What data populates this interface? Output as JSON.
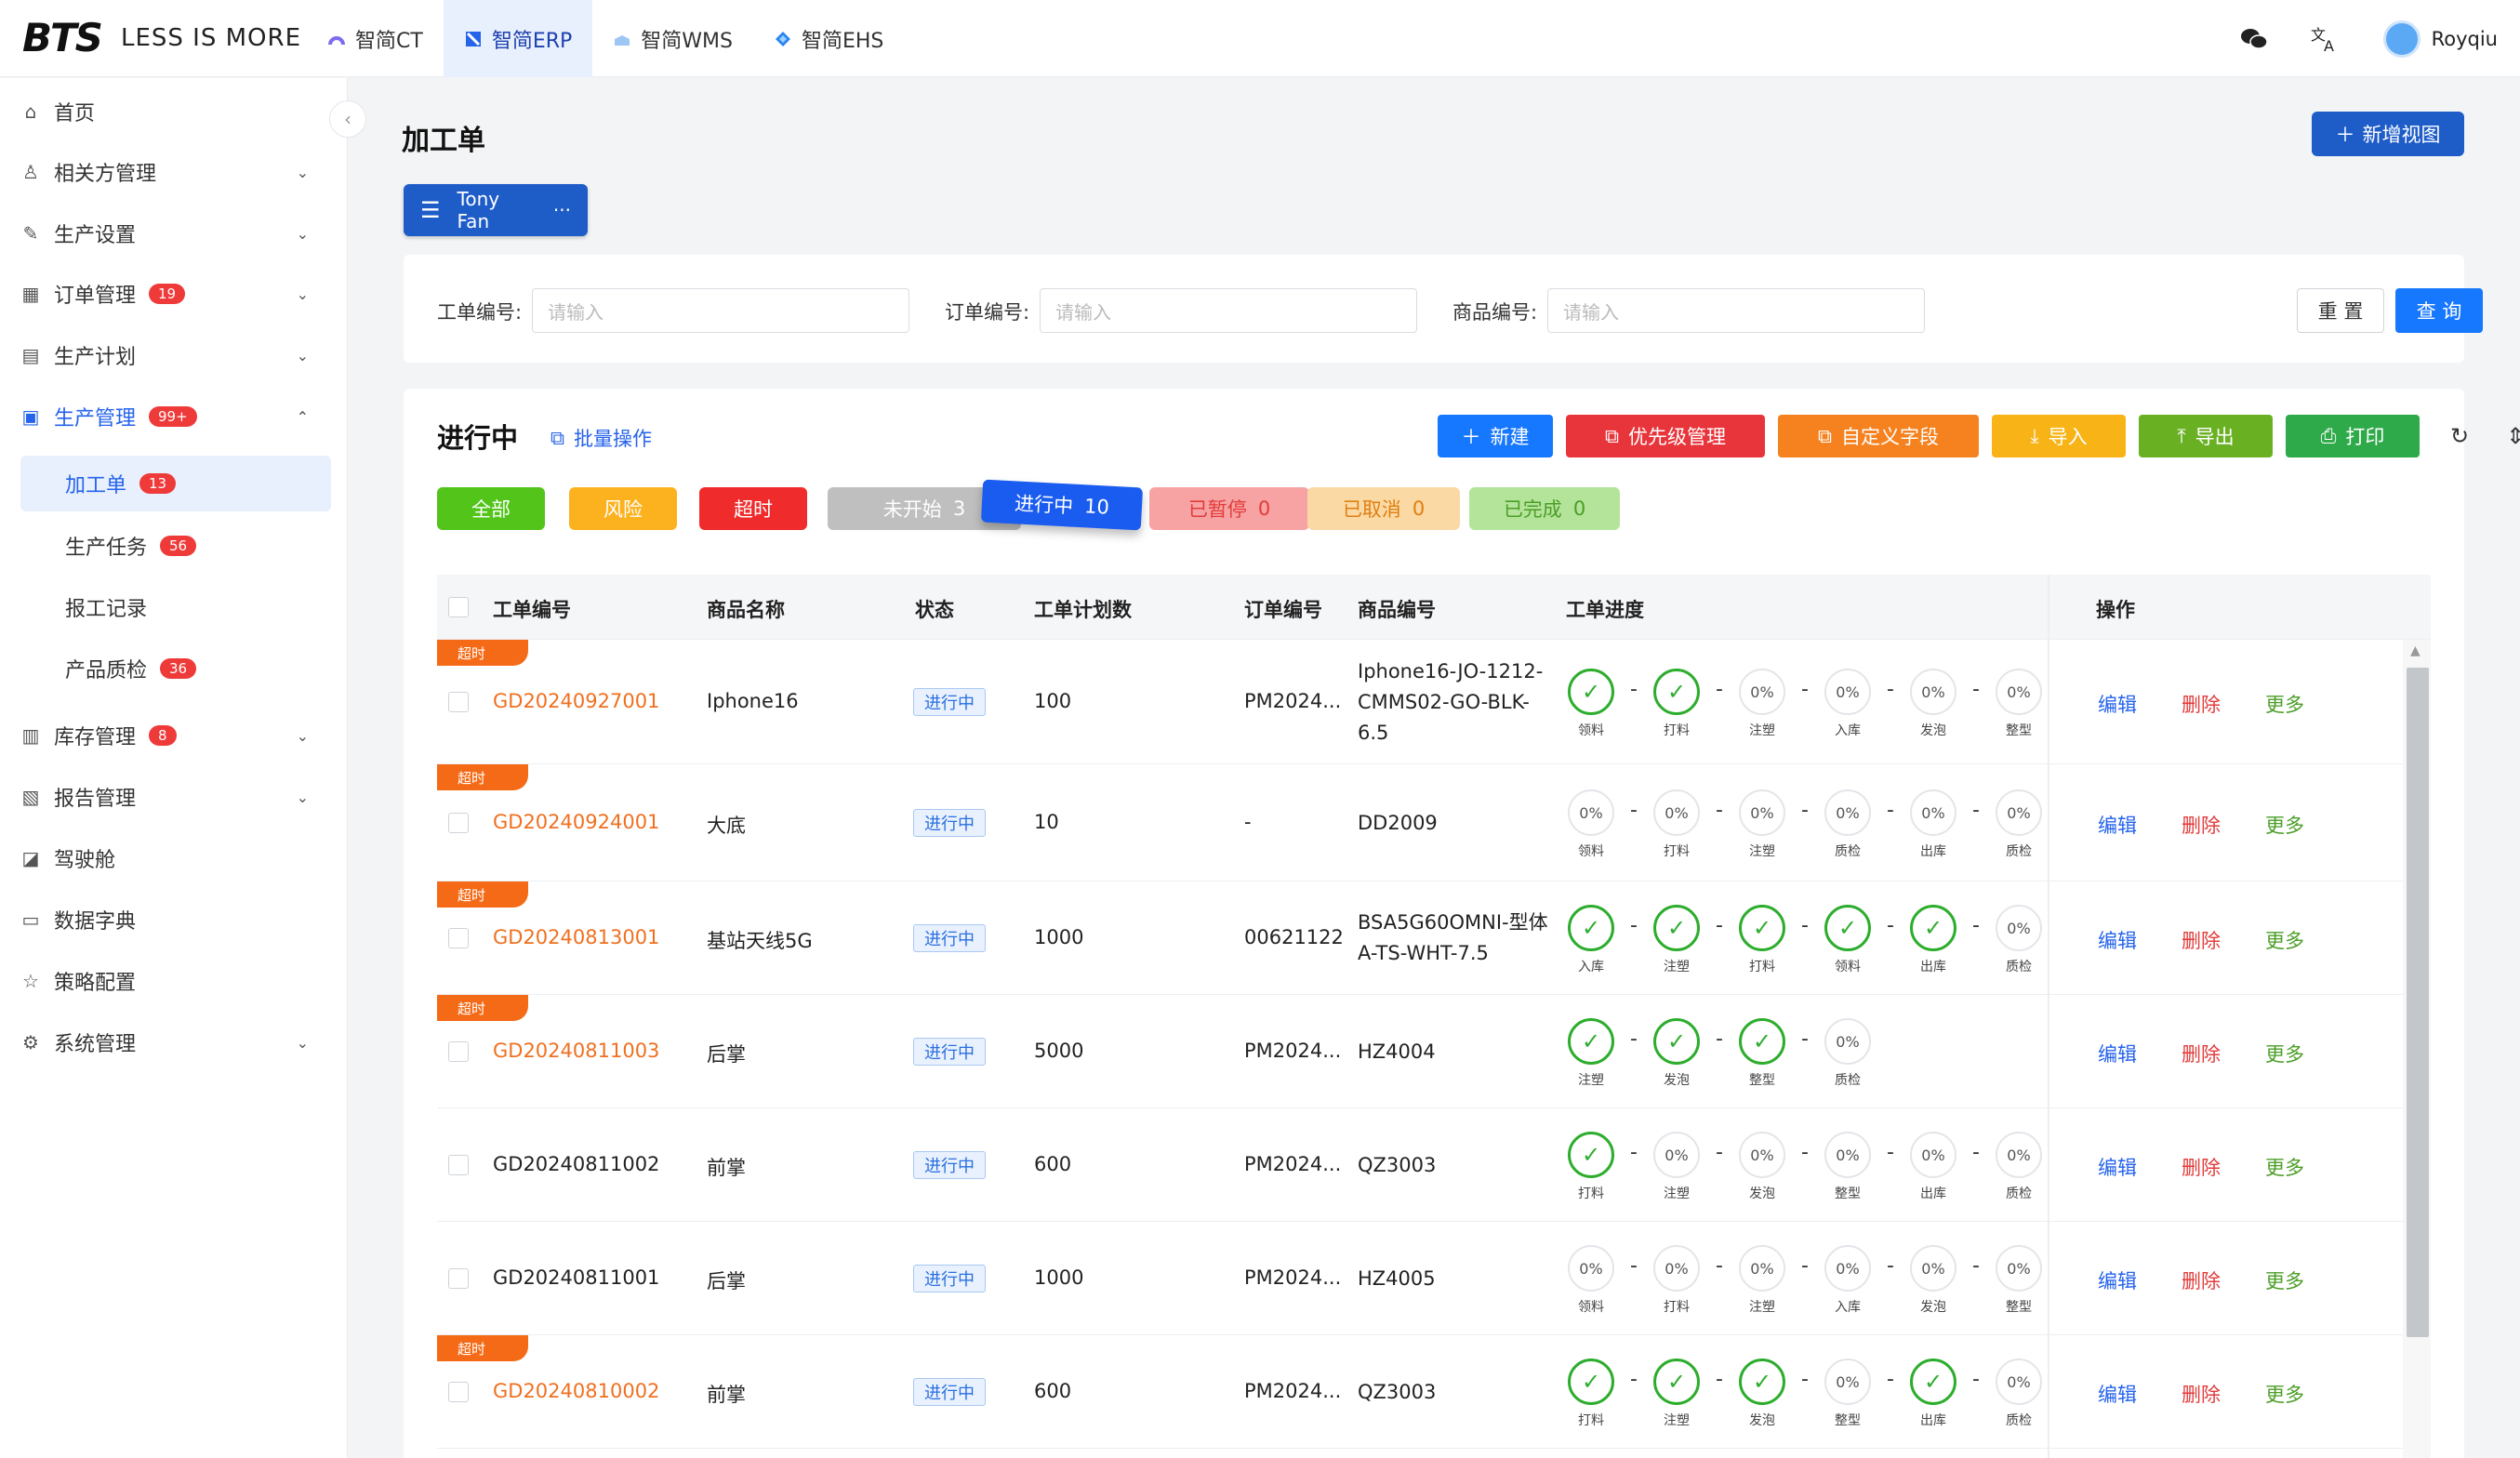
{
  "topbar": {
    "logo": "BTS",
    "slogan": "LESS IS MORE",
    "apps": [
      {
        "label": "智简CT",
        "icon": "ct-app-icon"
      },
      {
        "label": "智简ERP",
        "icon": "erp-app-icon",
        "active": true
      },
      {
        "label": "智简WMS",
        "icon": "wms-app-icon"
      },
      {
        "label": "智简EHS",
        "icon": "ehs-app-icon"
      }
    ],
    "user": "Royqiu"
  },
  "sidebar": {
    "items": [
      {
        "label": "首页",
        "icon": "home-icon"
      },
      {
        "label": "相关方管理",
        "icon": "user-icon"
      },
      {
        "label": "生产设置",
        "icon": "pen-icon"
      },
      {
        "label": "订单管理",
        "icon": "grid-icon",
        "badge": "19"
      },
      {
        "label": "生产计划",
        "icon": "calendar-icon"
      },
      {
        "label": "生产管理",
        "icon": "layers-icon",
        "badge": "99+"
      },
      {
        "label": "库存管理",
        "icon": "box-icon",
        "badge": "8"
      },
      {
        "label": "报告管理",
        "icon": "report-icon"
      },
      {
        "label": "驾驶舱",
        "icon": "chart-icon"
      },
      {
        "label": "数据字典",
        "icon": "book-icon"
      },
      {
        "label": "策略配置",
        "icon": "strategy-icon"
      },
      {
        "label": "系统管理",
        "icon": "settings-icon"
      }
    ],
    "sub": [
      {
        "label": "加工单",
        "badge": "13"
      },
      {
        "label": "生产任务",
        "badge": "56"
      },
      {
        "label": "报工记录"
      },
      {
        "label": "产品质检",
        "badge": "36"
      }
    ]
  },
  "page": {
    "title": "加工单",
    "add_view": "新增视图",
    "view_tab": "Tony Fan"
  },
  "filters": {
    "work_order_label": "工单编号:",
    "order_label": "订单编号:",
    "product_label": "商品编号:",
    "placeholder": "请输入",
    "reset": "重 置",
    "query": "查 询"
  },
  "section": {
    "title": "进行中",
    "batch": "批量操作",
    "actions": [
      {
        "label": "新建",
        "color": "#1677ff"
      },
      {
        "label": "优先级管理",
        "color": "#e8353b"
      },
      {
        "label": "自定义字段",
        "color": "#f5821f"
      },
      {
        "label": "导入",
        "color": "#f8b316"
      },
      {
        "label": "导出",
        "color": "#6ab023"
      },
      {
        "label": "打印",
        "color": "#2eaa4a"
      }
    ]
  },
  "status_tabs": [
    {
      "label": "全部",
      "count": "",
      "bg": "#52c41a",
      "fg": "#ffffff"
    },
    {
      "label": "风险",
      "count": "",
      "bg": "#fcb21e",
      "fg": "#ffffff"
    },
    {
      "label": "超时",
      "count": "",
      "bg": "#ef2b2b",
      "fg": "#ffffff"
    },
    {
      "label": "未开始",
      "count": "3",
      "bg": "#bfbfbf",
      "fg": "#ffffff"
    },
    {
      "label": "进行中",
      "count": "10",
      "bg": "#1b5cf0",
      "fg": "#ffffff"
    },
    {
      "label": "已暂停",
      "count": "0",
      "bg": "#f7a3a3",
      "fg": "#e23b3b"
    },
    {
      "label": "已取消",
      "count": "0",
      "bg": "#fbd9a4",
      "fg": "#e07e12"
    },
    {
      "label": "已完成",
      "count": "0",
      "bg": "#b4e49a",
      "fg": "#4b9e27"
    }
  ],
  "table": {
    "headers": [
      "工单编号",
      "商品名称",
      "状态",
      "工单计划数",
      "订单编号",
      "商品编号",
      "工单进度",
      "操作"
    ],
    "overtime_label": "超时",
    "status_label": "进行中",
    "ops": [
      "编辑",
      "删除",
      "更多"
    ],
    "rows": [
      {
        "id": "GD20240927001",
        "name": "Iphone16",
        "plan": "100",
        "order": "PM2024...",
        "product": [
          "Iphone16-JO-1212-",
          "CMMS02-GO-BLK-",
          "6.5"
        ],
        "overtime": true,
        "steps": [
          {
            "l": "领料",
            "d": true
          },
          {
            "l": "打料",
            "d": true
          },
          {
            "l": "注塑",
            "d": false
          },
          {
            "l": "入库",
            "d": false
          },
          {
            "l": "发泡",
            "d": false
          },
          {
            "l": "整型",
            "d": false
          }
        ]
      },
      {
        "id": "GD20240924001",
        "name": "大底",
        "plan": "10",
        "order": "-",
        "product": [
          "DD2009"
        ],
        "overtime": true,
        "steps": [
          {
            "l": "领料",
            "d": false
          },
          {
            "l": "打料",
            "d": false
          },
          {
            "l": "注塑",
            "d": false
          },
          {
            "l": "质检",
            "d": false
          },
          {
            "l": "出库",
            "d": false
          },
          {
            "l": "质检",
            "d": false
          }
        ]
      },
      {
        "id": "GD20240813001",
        "name": "基站天线5G",
        "plan": "1000",
        "order": "00621122",
        "product": [
          "BSA5G60OMNI-型体",
          "A-TS-WHT-7.5"
        ],
        "overtime": true,
        "steps": [
          {
            "l": "入库",
            "d": true
          },
          {
            "l": "注塑",
            "d": true
          },
          {
            "l": "打料",
            "d": true
          },
          {
            "l": "领料",
            "d": true
          },
          {
            "l": "出库",
            "d": true
          },
          {
            "l": "质检",
            "d": false
          }
        ]
      },
      {
        "id": "GD20240811003",
        "name": "后掌",
        "plan": "5000",
        "order": "PM2024...",
        "product": [
          "HZ4004"
        ],
        "overtime": true,
        "steps": [
          {
            "l": "注塑",
            "d": true
          },
          {
            "l": "发泡",
            "d": true
          },
          {
            "l": "整型",
            "d": true
          },
          {
            "l": "质检",
            "d": false
          }
        ]
      },
      {
        "id": "GD20240811002",
        "name": "前掌",
        "plan": "600",
        "order": "PM2024...",
        "product": [
          "QZ3003"
        ],
        "overtime": false,
        "steps": [
          {
            "l": "打料",
            "d": true
          },
          {
            "l": "注塑",
            "d": false
          },
          {
            "l": "发泡",
            "d": false
          },
          {
            "l": "整型",
            "d": false
          },
          {
            "l": "出库",
            "d": false
          },
          {
            "l": "质检",
            "d": false
          }
        ]
      },
      {
        "id": "GD20240811001",
        "name": "后掌",
        "plan": "1000",
        "order": "PM2024...",
        "product": [
          "HZ4005"
        ],
        "overtime": false,
        "steps": [
          {
            "l": "领料",
            "d": false
          },
          {
            "l": "打料",
            "d": false
          },
          {
            "l": "注塑",
            "d": false
          },
          {
            "l": "入库",
            "d": false
          },
          {
            "l": "发泡",
            "d": false
          },
          {
            "l": "整型",
            "d": false
          }
        ]
      },
      {
        "id": "GD20240810002",
        "name": "前掌",
        "plan": "600",
        "order": "PM2024...",
        "product": [
          "QZ3003"
        ],
        "overtime": true,
        "steps": [
          {
            "l": "打料",
            "d": true
          },
          {
            "l": "注塑",
            "d": true
          },
          {
            "l": "发泡",
            "d": true
          },
          {
            "l": "整型",
            "d": false
          },
          {
            "l": "出库",
            "d": true
          },
          {
            "l": "质检",
            "d": false
          }
        ]
      }
    ],
    "pct": "0%",
    "check": "✓"
  }
}
